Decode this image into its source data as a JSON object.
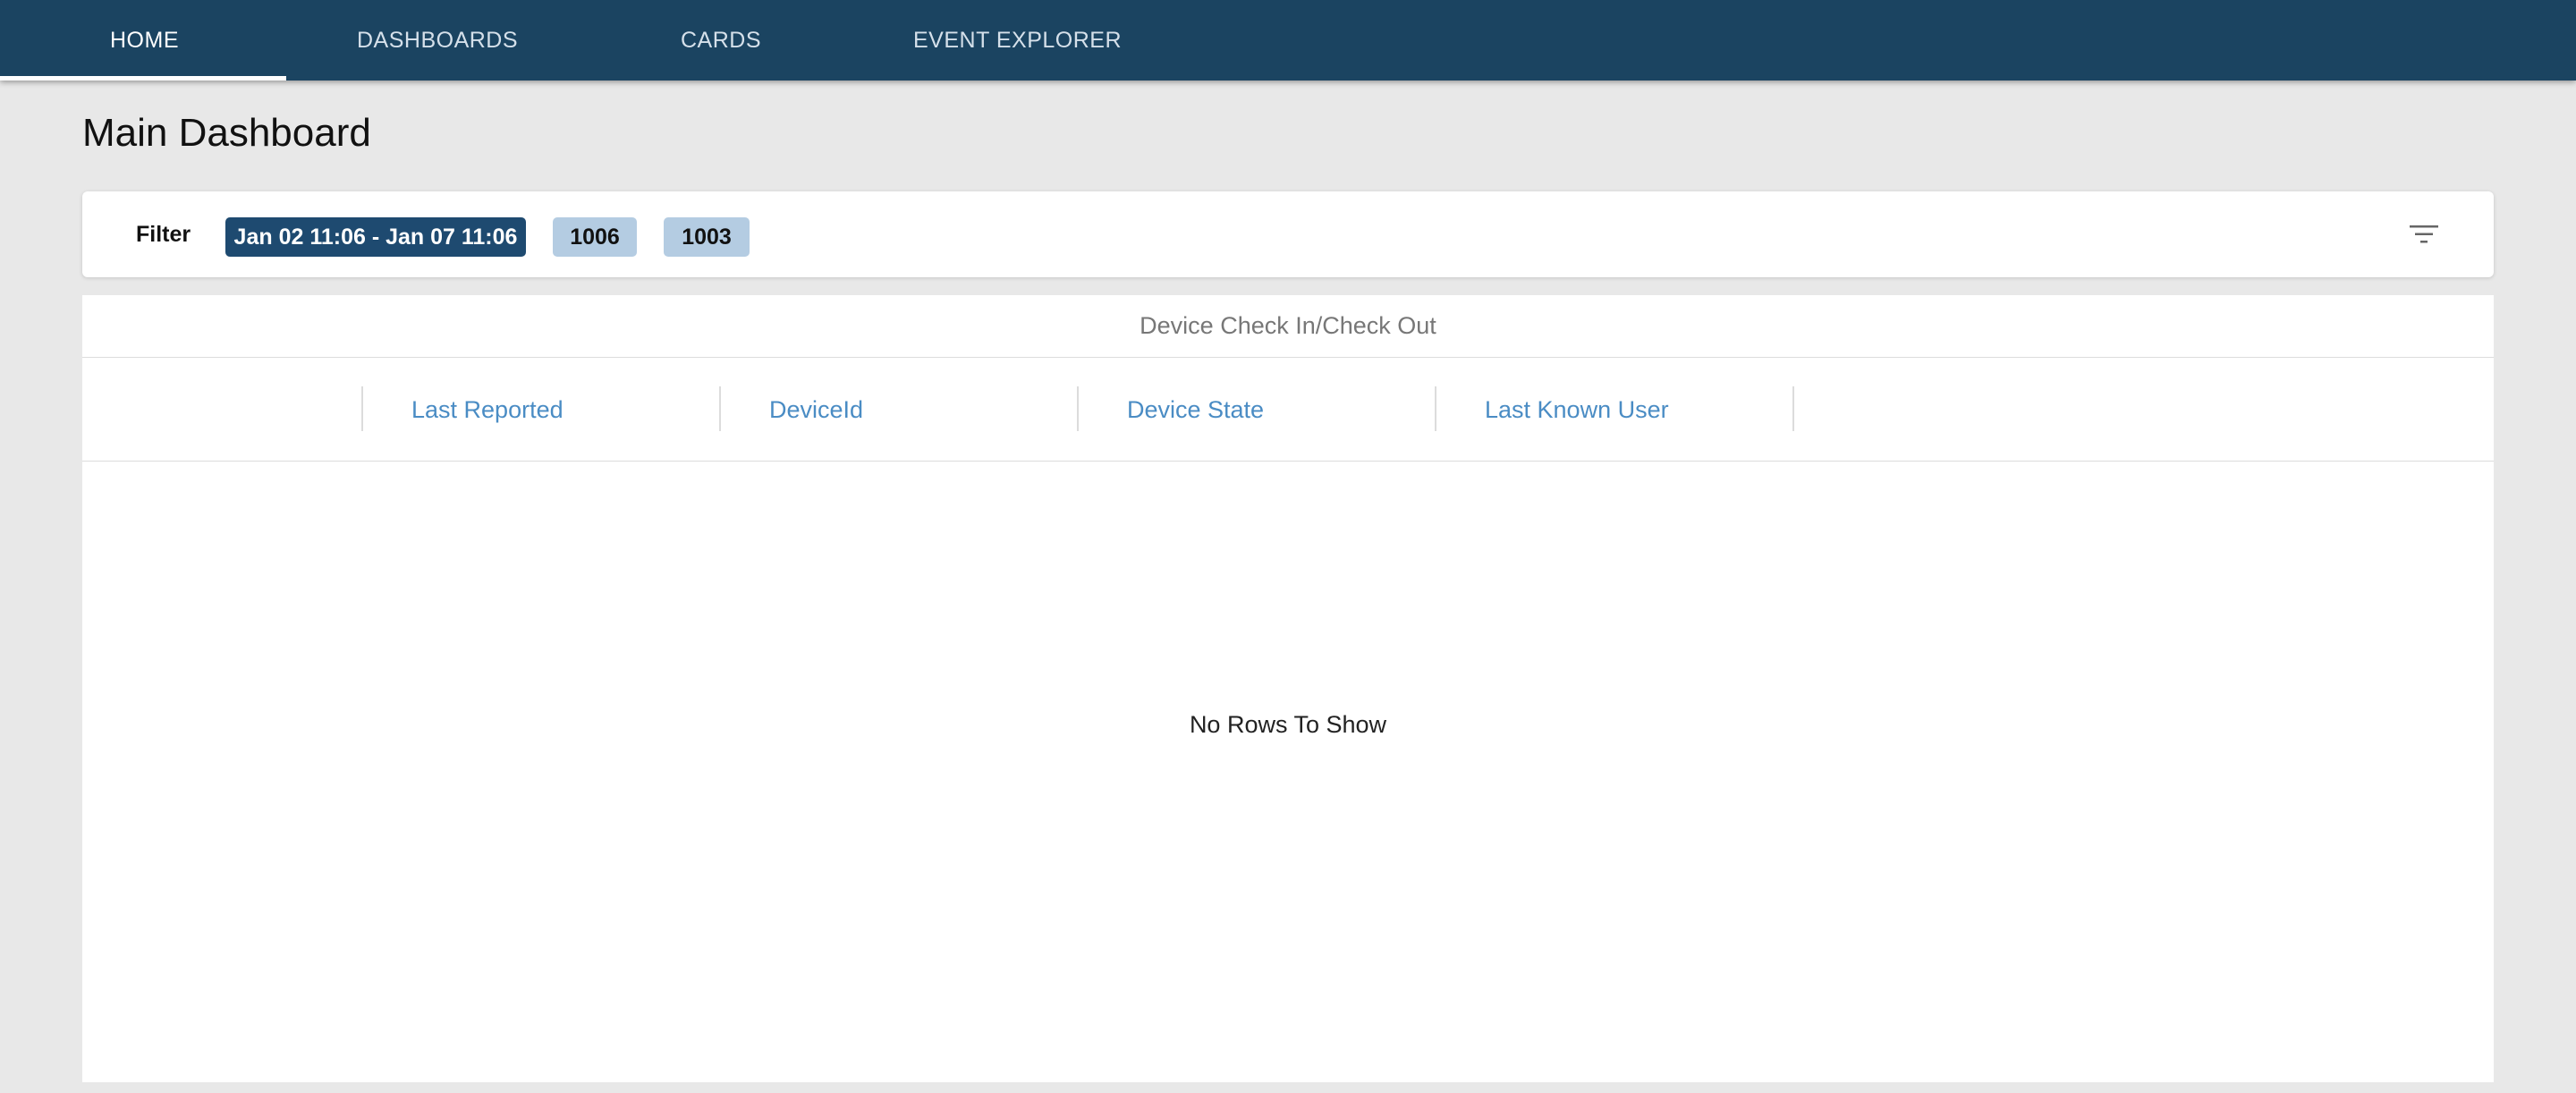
{
  "nav": {
    "tabs": [
      {
        "label": "HOME",
        "active": true
      },
      {
        "label": "DASHBOARDS",
        "active": false
      },
      {
        "label": "CARDS",
        "active": false
      },
      {
        "label": "EVENT EXPLORER",
        "active": false
      }
    ]
  },
  "page": {
    "title": "Main Dashboard"
  },
  "filter": {
    "label": "Filter",
    "date_range": "Jan 02 11:06 - Jan 07 11:06",
    "tags": [
      "1006",
      "1003"
    ],
    "icon": "filter-icon"
  },
  "grid": {
    "title": "Device Check In/Check Out",
    "columns": [
      "Last Reported",
      "DeviceId",
      "Device State",
      "Last Known User"
    ],
    "empty_message": "No Rows To Show"
  },
  "colors": {
    "nav_background": "#1b4461",
    "date_chip": "#1e4a70",
    "tag_chip": "#b4cce2",
    "column_header_text": "#4a8cc4",
    "page_background": "#e8e8e8"
  }
}
